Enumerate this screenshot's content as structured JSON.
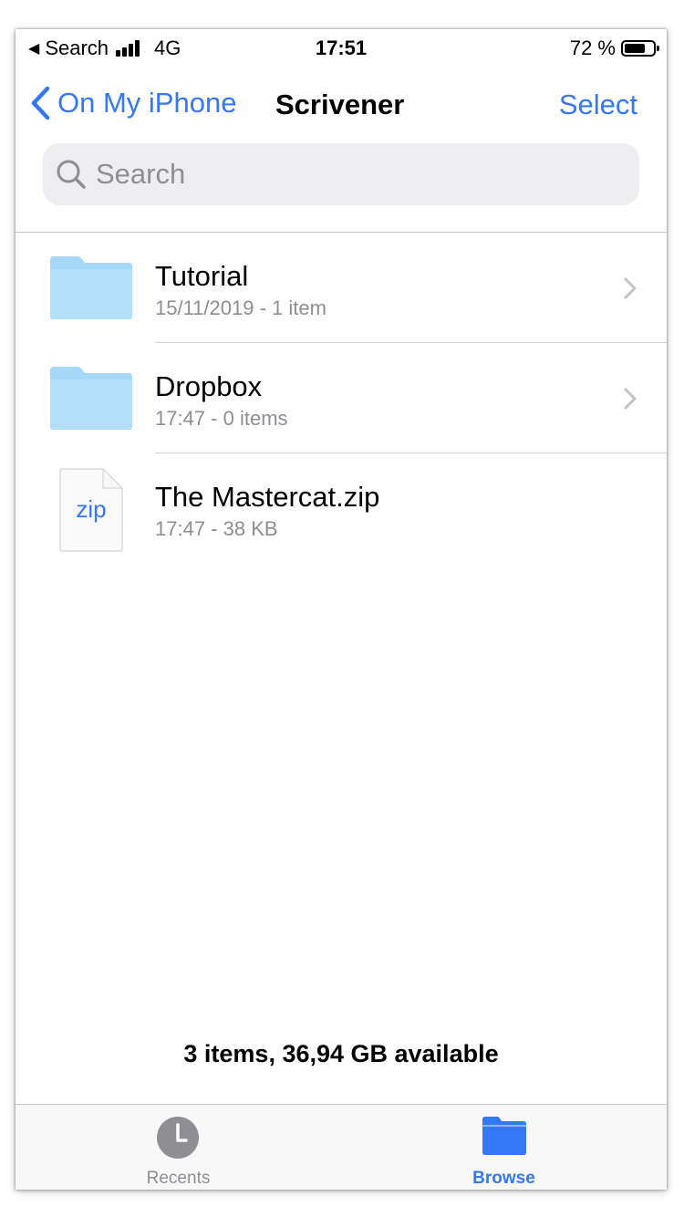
{
  "status_bar": {
    "back_app": "Search",
    "network": "4G",
    "time": "17:51",
    "battery_percent": "72 %",
    "battery_level": 0.72
  },
  "nav": {
    "back_label": "On My iPhone",
    "title": "Scrivener",
    "select_label": "Select"
  },
  "search": {
    "placeholder": "Search"
  },
  "files": [
    {
      "name": "Tutorial",
      "meta": "15/11/2019 - 1 item",
      "kind": "folder-icon"
    },
    {
      "name": "Dropbox",
      "meta": "17:47 - 0 items",
      "kind": "folder-icon"
    },
    {
      "name": "The Mastercat.zip",
      "meta": "17:47 - 38 KB",
      "kind": "zip-file-icon",
      "icon_text": "zip"
    }
  ],
  "summary": "3 items, 36,94 GB available",
  "tabs": [
    {
      "label": "Recents",
      "icon": "clock-icon",
      "active": false
    },
    {
      "label": "Browse",
      "icon": "folder-icon",
      "active": true
    }
  ],
  "colors": {
    "accent": "#3478f6",
    "folder": "#a9dbfa",
    "secondary_text": "#8e8e93",
    "search_bg": "#eeeef0"
  }
}
